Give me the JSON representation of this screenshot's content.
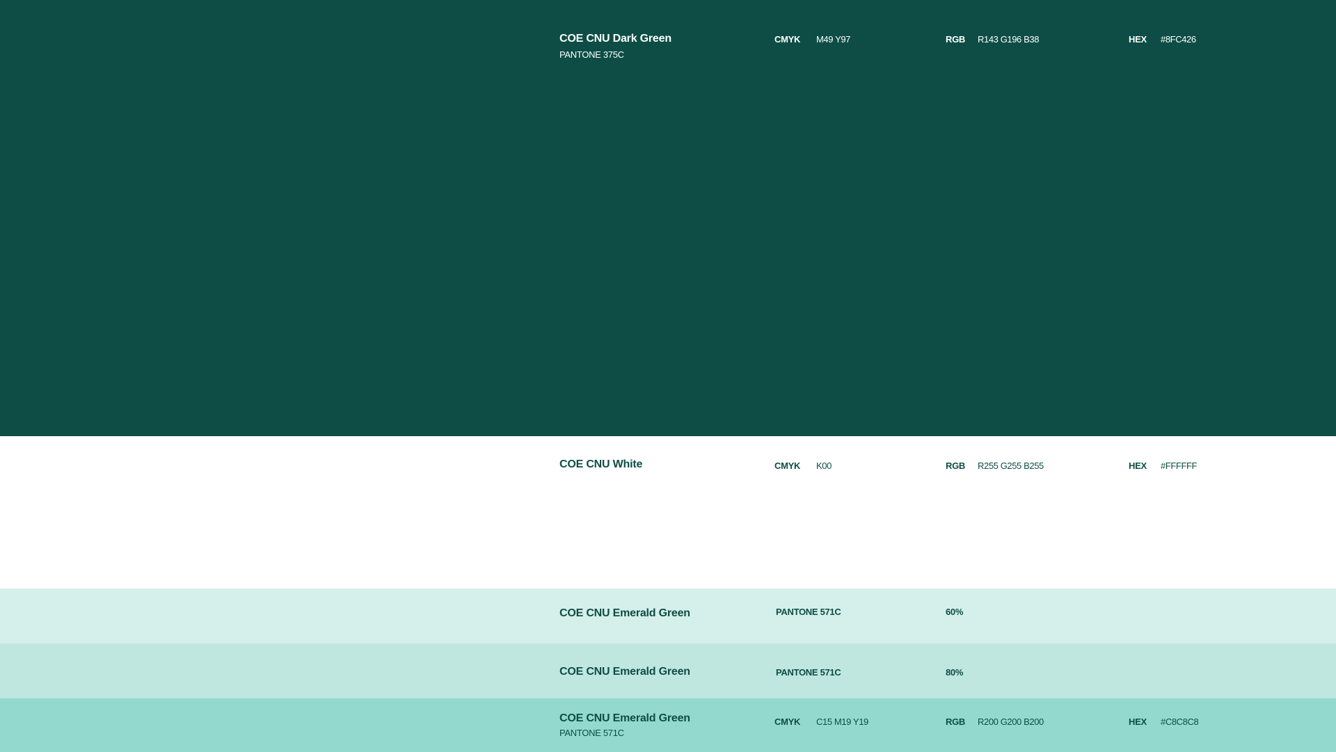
{
  "colors": {
    "dark_green": "#0D4D45",
    "white": "#FFFFFF",
    "emerald_60": "#D5EFEA",
    "emerald_80": "#BFE7DF",
    "emerald_100": "#93D9CE"
  },
  "dark_green": {
    "name": "COE CNU Dark Green",
    "pantone": "PANTONE 375C",
    "cmyk_label": "CMYK",
    "cmyk_value": "M49 Y97",
    "rgb_label": "RGB",
    "rgb_value": "R143 G196 B38",
    "hex_label": "HEX",
    "hex_value": "#8FC426"
  },
  "white": {
    "name": "COE CNU White",
    "cmyk_label": "CMYK",
    "cmyk_value": "K00",
    "rgb_label": "RGB",
    "rgb_value": "R255 G255 B255",
    "hex_label": "HEX",
    "hex_value": "#FFFFFF"
  },
  "emerald_60": {
    "name": "COE CNU Emerald Green",
    "pantone": "PANTONE 571C",
    "tint": "60%"
  },
  "emerald_80": {
    "name": "COE CNU Emerald Green",
    "pantone": "PANTONE 571C",
    "tint": "80%"
  },
  "emerald": {
    "name": "COE CNU Emerald Green",
    "pantone": "PANTONE 571C",
    "cmyk_label": "CMYK",
    "cmyk_value": "C15 M19 Y19",
    "rgb_label": "RGB",
    "rgb_value": "R200 G200 B200",
    "hex_label": "HEX",
    "hex_value": "#C8C8C8"
  }
}
